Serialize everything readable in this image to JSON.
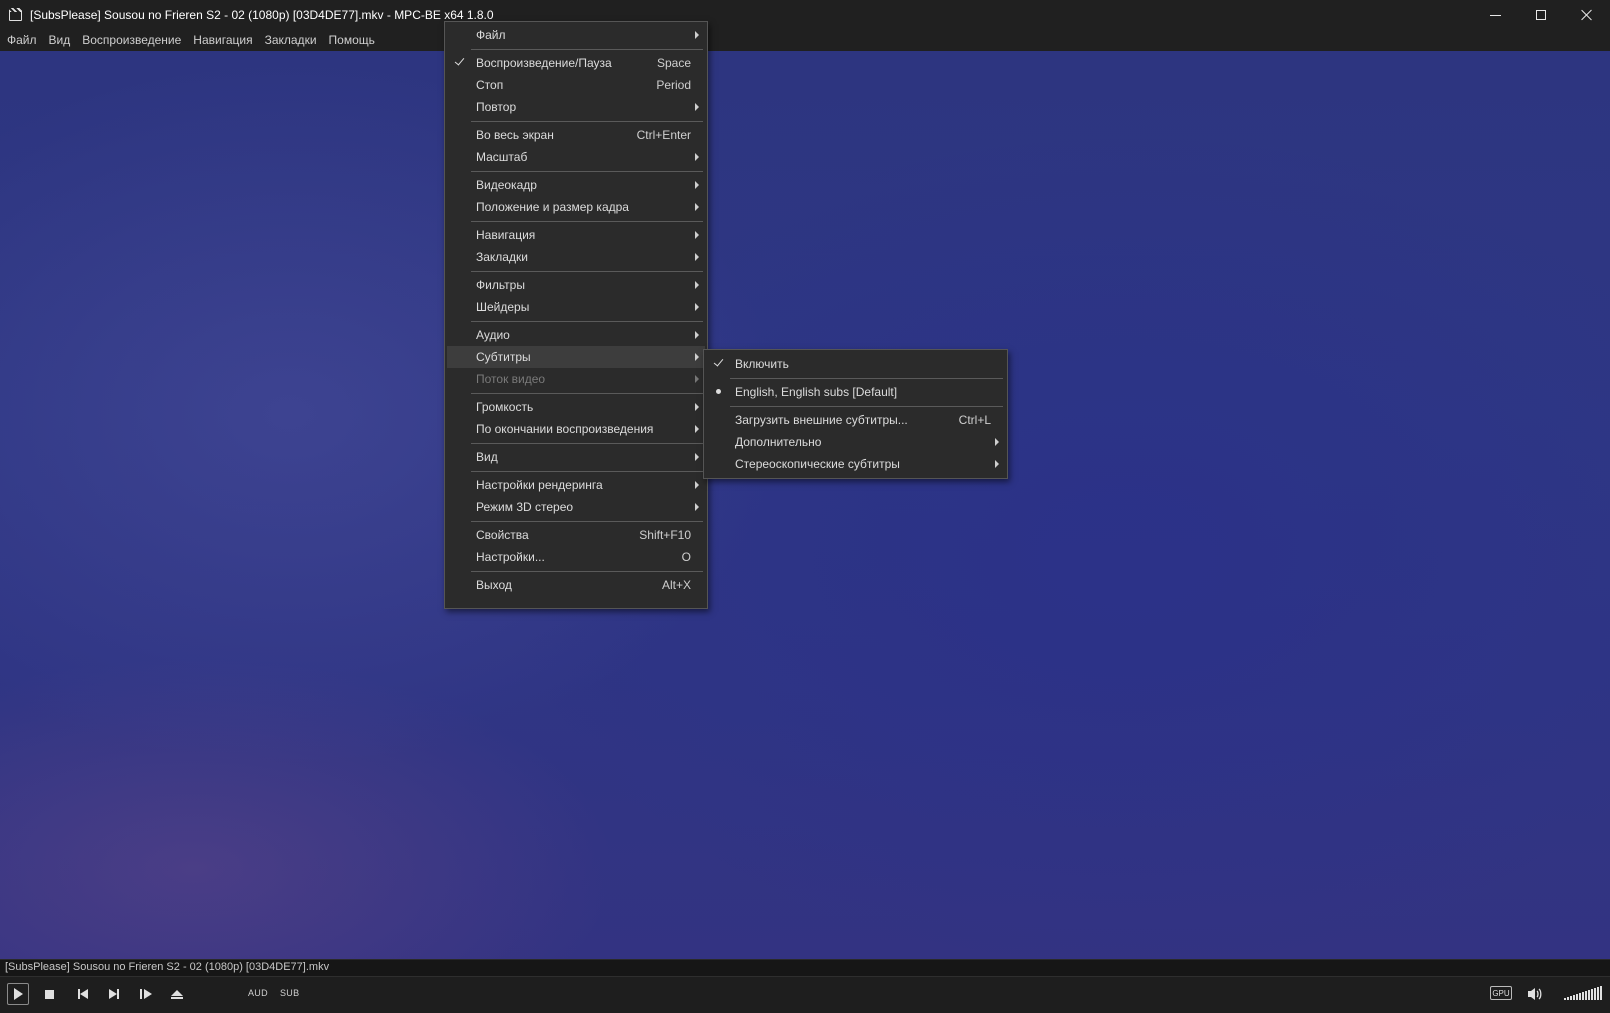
{
  "window": {
    "title": "[SubsPlease] Sousou no Frieren S2 - 02 (1080p) [03D4DE77].mkv - MPC-BE x64 1.8.0"
  },
  "menubar": {
    "items": [
      "Файл",
      "Вид",
      "Воспроизведение",
      "Навигация",
      "Закладки",
      "Помощь"
    ]
  },
  "context_menu": {
    "items": [
      {
        "label": "Файл",
        "submenu": true
      },
      {
        "label": "Воспроизведение/Пауза",
        "shortcut": "Space",
        "checked": true
      },
      {
        "label": "Стоп",
        "shortcut": "Period"
      },
      {
        "label": "Повтор",
        "submenu": true
      },
      {
        "label": "Во весь экран",
        "shortcut": "Ctrl+Enter"
      },
      {
        "label": "Масштаб",
        "submenu": true
      },
      {
        "label": "Видеокадр",
        "submenu": true
      },
      {
        "label": "Положение и размер кадра",
        "submenu": true
      },
      {
        "label": "Навигация",
        "submenu": true
      },
      {
        "label": "Закладки",
        "submenu": true
      },
      {
        "label": "Фильтры",
        "submenu": true
      },
      {
        "label": "Шейдеры",
        "submenu": true
      },
      {
        "label": "Аудио",
        "submenu": true
      },
      {
        "label": "Субтитры",
        "submenu": true,
        "highlighted": true
      },
      {
        "label": "Поток видео",
        "submenu": true,
        "disabled": true
      },
      {
        "label": "Громкость",
        "submenu": true
      },
      {
        "label": "По окончании воспроизведения",
        "submenu": true
      },
      {
        "label": "Вид",
        "submenu": true
      },
      {
        "label": "Настройки рендеринга",
        "submenu": true
      },
      {
        "label": "Режим 3D стерео",
        "submenu": true
      },
      {
        "label": "Свойства",
        "shortcut": "Shift+F10"
      },
      {
        "label": "Настройки...",
        "shortcut": "O"
      },
      {
        "label": "Выход",
        "shortcut": "Alt+X"
      }
    ]
  },
  "subtitles_menu": {
    "items": [
      {
        "label": "Включить",
        "checked": true
      },
      {
        "label": "English, English subs [Default]",
        "radio": true
      },
      {
        "label": "Загрузить внешние субтитры...",
        "shortcut": "Ctrl+L"
      },
      {
        "label": "Дополнительно",
        "submenu": true
      },
      {
        "label": "Стереоскопические субтитры",
        "submenu": true
      }
    ]
  },
  "statusbar": {
    "filename": "[SubsPlease] Sousou no Frieren S2 - 02 (1080p) [03D4DE77].mkv"
  },
  "controls": {
    "audio_label": "AUD",
    "sub_label": "SUB",
    "gpu_label": "GPU"
  }
}
